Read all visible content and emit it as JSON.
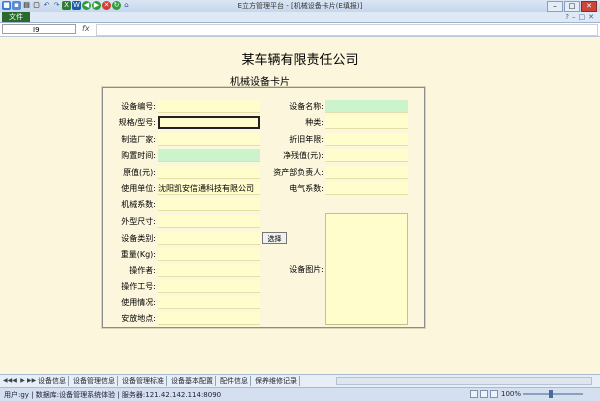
{
  "window": {
    "title": "E立方管理平台 - [机械设备卡片(E填报)]",
    "quick_access_icons": [
      "app-icon",
      "save-icon",
      "print-icon",
      "preview-icon",
      "undo-icon",
      "redo-icon",
      "excel-icon",
      "word-icon",
      "back-icon",
      "forward-icon",
      "stop-icon",
      "refresh-icon",
      "home-icon"
    ],
    "buttons": [
      "minimize",
      "maximize",
      "close"
    ]
  },
  "ribbon": {
    "file_tab": "文件"
  },
  "formula_bar": {
    "cell_ref": "I9",
    "fx": "fx",
    "value": ""
  },
  "sheet": {
    "company": "某车辆有限责任公司",
    "card_title": "机械设备卡片",
    "left_fields": [
      {
        "label": "设备编号:",
        "value": ""
      },
      {
        "label": "规格/型号:",
        "value": ""
      },
      {
        "label": "制造厂家:",
        "value": ""
      },
      {
        "label": "购置时间:",
        "value": ""
      },
      {
        "label": "原值(元):",
        "value": ""
      },
      {
        "label": "使用单位:",
        "value": "沈阳凯安信通科技有限公司"
      },
      {
        "label": "机械系数:",
        "value": ""
      },
      {
        "label": "外型尺寸:",
        "value": ""
      },
      {
        "label": "设备类别:",
        "value": ""
      },
      {
        "label": "重量(Kg):",
        "value": ""
      },
      {
        "label": "操作者:",
        "value": ""
      },
      {
        "label": "操作工号:",
        "value": ""
      },
      {
        "label": "使用情况:",
        "value": ""
      },
      {
        "label": "安放地点:",
        "value": ""
      }
    ],
    "right_fields": [
      {
        "label": "设备名称:",
        "value": ""
      },
      {
        "label": "种类:",
        "value": ""
      },
      {
        "label": "折旧年限:",
        "value": ""
      },
      {
        "label": "净残值(元):",
        "value": ""
      },
      {
        "label": "资产部负责人:",
        "value": ""
      },
      {
        "label": "电气系数:",
        "value": ""
      }
    ],
    "choose_button": "选择",
    "photo_label": "设备图片:"
  },
  "tabs": [
    "设备信息",
    "设备管理信息",
    "设备管理标准",
    "设备基本配置",
    "配件信息",
    "保养维修记录"
  ],
  "status": {
    "text": "用户:gy | 数据库:设备管理系统体验 | 服务器:121.42.142.114:8090",
    "zoom": "100%"
  },
  "colors": {
    "sheet_bg": "#fbf6dc",
    "input_yellow": "#fffdcc",
    "input_green": "#ccf4cc",
    "file_tab": "#2a6a2e"
  }
}
